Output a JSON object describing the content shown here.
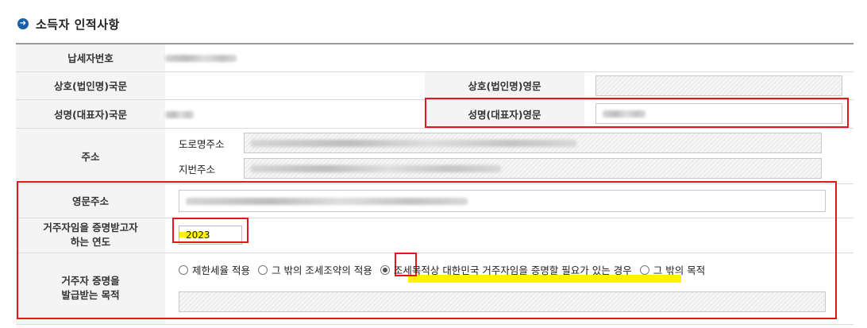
{
  "section": {
    "title": "소득자 인적사항",
    "icon": "arrow-right-circle-icon"
  },
  "fields": {
    "taxpayer_number": {
      "label": "납세자번호",
      "value": ""
    },
    "business_name_kr": {
      "label": "상호(법인명)국문",
      "value": ""
    },
    "business_name_en": {
      "label": "상호(법인명)영문",
      "value": ""
    },
    "rep_name_kr": {
      "label": "성명(대표자)국문",
      "value": ""
    },
    "rep_name_en": {
      "label": "성명(대표자)영문",
      "value": ""
    },
    "address": {
      "label": "주소",
      "road_label": "도로명주소",
      "lot_label": "지번주소"
    },
    "address_en": {
      "label": "영문주소",
      "value": ""
    },
    "cert_year": {
      "label_line1": "거주자임을 증명받고자",
      "label_line2": "하는 연도",
      "value": "2023"
    },
    "purpose": {
      "label_line1": "거주자 증명을",
      "label_line2": "발급받는 목적",
      "options": [
        {
          "label": "제한세율 적용",
          "selected": false
        },
        {
          "label": "그 밖의 조세조약의 적용",
          "selected": false
        },
        {
          "label": "조세목적상 대한민국 거주자임을 증명할 필요가 있는 경우",
          "selected": true
        },
        {
          "label": "그 밖의 목적",
          "selected": false
        }
      ],
      "other_value": ""
    }
  },
  "colors": {
    "annotation_red": "#e8141b",
    "highlight_yellow": "#fff200",
    "section_icon": "#1b5fa8"
  }
}
